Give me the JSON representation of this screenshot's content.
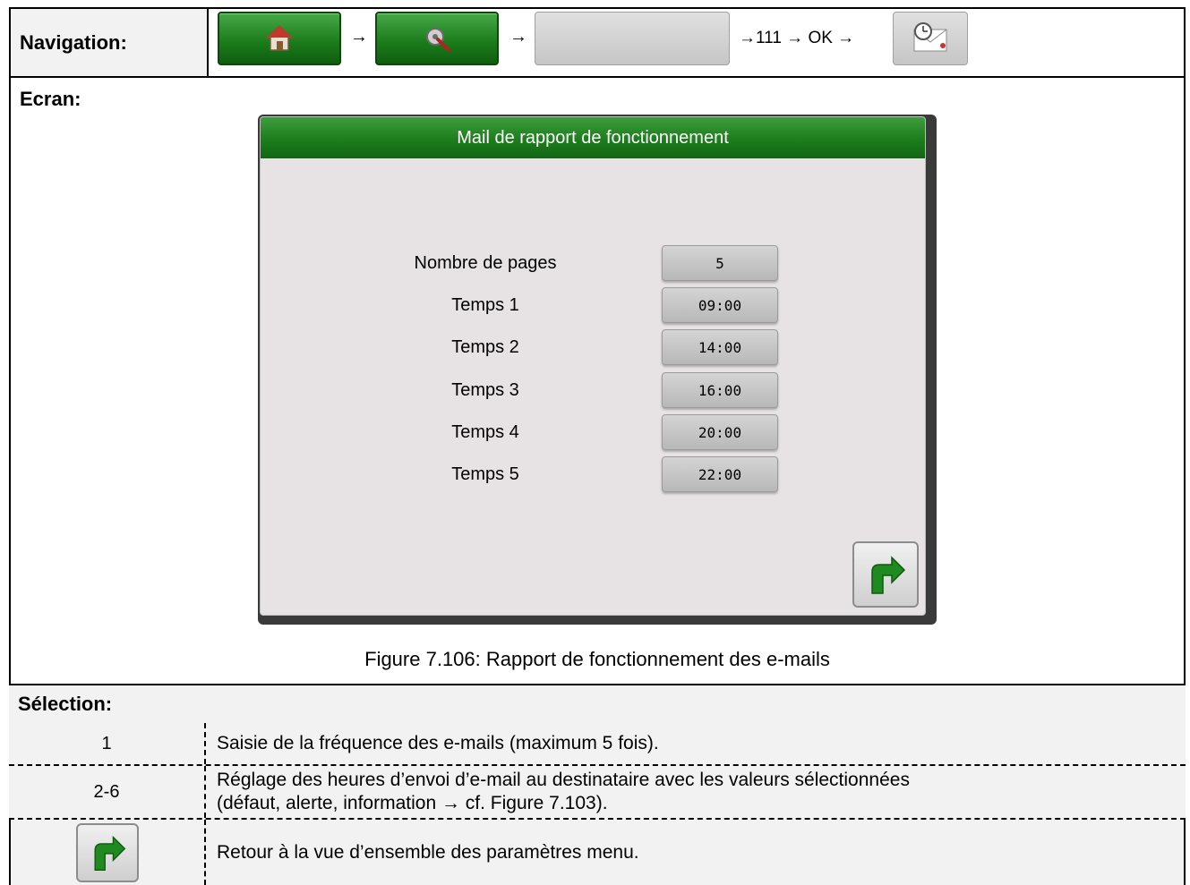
{
  "navigation": {
    "label": "Navigation:",
    "icons": [
      "home-icon",
      "settings-tools-icon",
      "clock-mail-icon"
    ],
    "arrow": "→",
    "sequence_text": "→111 → OK →"
  },
  "ecran": {
    "label": "Ecran:"
  },
  "screen": {
    "title": "Mail de rapport de fonctionnement",
    "params": [
      {
        "label": "Nombre de pages",
        "value": "5"
      },
      {
        "label": "Temps 1",
        "value": "09:00"
      },
      {
        "label": "Temps 2",
        "value": "14:00"
      },
      {
        "label": "Temps 3",
        "value": "16:00"
      },
      {
        "label": "Temps 4",
        "value": "20:00"
      },
      {
        "label": "Temps 5",
        "value": "22:00"
      }
    ],
    "back_icon": "return-arrow-icon"
  },
  "figure_caption": "Figure 7.106: Rapport de fonctionnement des e-mails",
  "selection": {
    "label": "Sélection:",
    "rows": [
      {
        "key": "1",
        "description": "Saisie de la fréquence des e-mails (maximum 5 fois)."
      },
      {
        "key": "2-6",
        "description_line1": "Réglage des heures d’envoi d’e-mail au destinataire avec les valeurs sélectionnées",
        "description_line2": "(défaut, alerte, information → cf. Figure 7.103)."
      },
      {
        "key_icon": "return-arrow-icon",
        "description": "Retour à la vue d’ensemble des paramètres menu."
      }
    ]
  },
  "colors": {
    "green": "#1d7d1d",
    "panel_bg": "#e7e3e5",
    "header_bg": "#f2f2f2"
  }
}
